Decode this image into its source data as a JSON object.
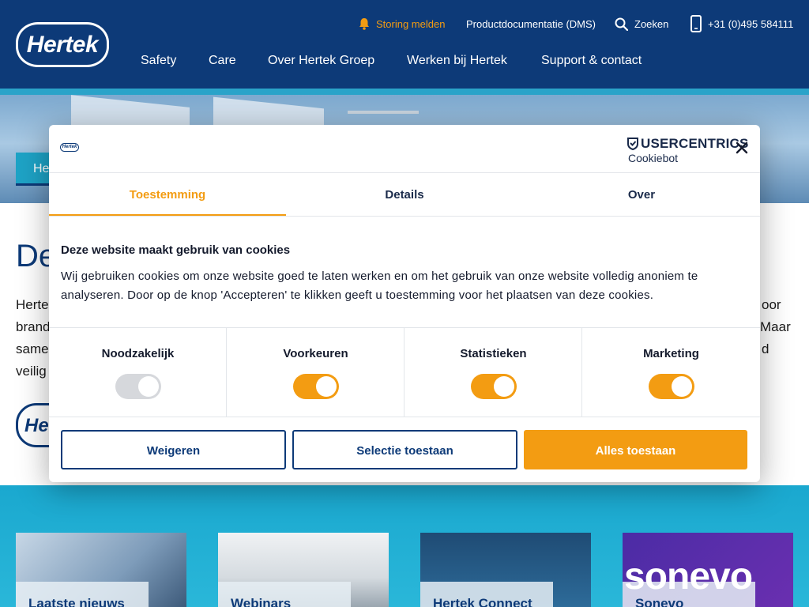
{
  "header": {
    "logo_text": "Hertek",
    "top_links": {
      "storing": "Storing melden",
      "dms": "Productdocumentatie (DMS)",
      "search": "Zoeken",
      "phone": "+31 (0)495 584111"
    },
    "nav": [
      "Safety",
      "Care",
      "Over Hertek Groep",
      "Werken bij Hertek",
      "Support & contact"
    ],
    "colors": {
      "navy": "#0d3a78",
      "orange": "#f39c12",
      "cyan": "#2aa3c9"
    }
  },
  "hero": {
    "tab_label": "He"
  },
  "intro": {
    "title": "De",
    "left_fragments": [
      "Herte",
      "brand",
      "same",
      "veilig"
    ],
    "right_fragments": [
      "oor",
      "Maar",
      "d"
    ],
    "logo_text": "He"
  },
  "cards": [
    {
      "label": "Laatste nieuws"
    },
    {
      "label": "Webinars"
    },
    {
      "label": "Hertek Connect"
    },
    {
      "label": "Sonevo",
      "brand": "sonevo"
    }
  ],
  "cookie_dialog": {
    "logo_text": "Hertek",
    "brand_line1": "USERCENTRICS",
    "brand_line2": "Cookiebot",
    "tabs": [
      "Toestemming",
      "Details",
      "Over"
    ],
    "active_tab": "Toestemming",
    "heading": "Deze website maakt gebruik van cookies",
    "body": "Wij gebruiken cookies om onze website goed te laten werken en om het gebruik van onze website volledig anoniem te analyseren. Door op de knop 'Accepteren' te klikken geeft u toestemming voor het plaatsen van deze cookies.",
    "categories": [
      {
        "label": "Noodzakelijk",
        "enabled": true,
        "disabled": true
      },
      {
        "label": "Voorkeuren",
        "enabled": true,
        "disabled": false
      },
      {
        "label": "Statistieken",
        "enabled": true,
        "disabled": false
      },
      {
        "label": "Marketing",
        "enabled": true,
        "disabled": false
      }
    ],
    "buttons": {
      "decline": "Weigeren",
      "allow_selection": "Selectie toestaan",
      "allow_all": "Alles toestaan"
    }
  }
}
